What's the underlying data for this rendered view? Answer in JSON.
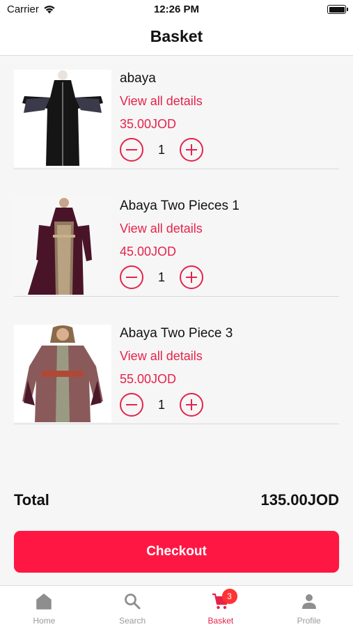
{
  "status_bar": {
    "carrier": "Carrier",
    "time": "12:26 PM"
  },
  "header": {
    "title": "Basket"
  },
  "basket": {
    "items": [
      {
        "name": "abaya",
        "details_link": "View all details",
        "price": "35.00JOD",
        "quantity": "1"
      },
      {
        "name": "Abaya Two Pieces 1",
        "details_link": "View all details",
        "price": "45.00JOD",
        "quantity": "1"
      },
      {
        "name": "Abaya Two Piece 3",
        "details_link": "View all details",
        "price": "55.00JOD",
        "quantity": "1"
      }
    ]
  },
  "summary": {
    "total_label": "Total",
    "total_value": "135.00JOD"
  },
  "checkout": {
    "label": "Checkout"
  },
  "tabs": [
    {
      "label": "Home",
      "icon": "home-icon"
    },
    {
      "label": "Search",
      "icon": "search-icon"
    },
    {
      "label": "Basket",
      "icon": "cart-icon",
      "badge": "3",
      "active": true
    },
    {
      "label": "Profile",
      "icon": "profile-icon"
    }
  ],
  "colors": {
    "accent": "#e5234a",
    "checkout_bg": "#ff1744",
    "badge": "#f33"
  }
}
